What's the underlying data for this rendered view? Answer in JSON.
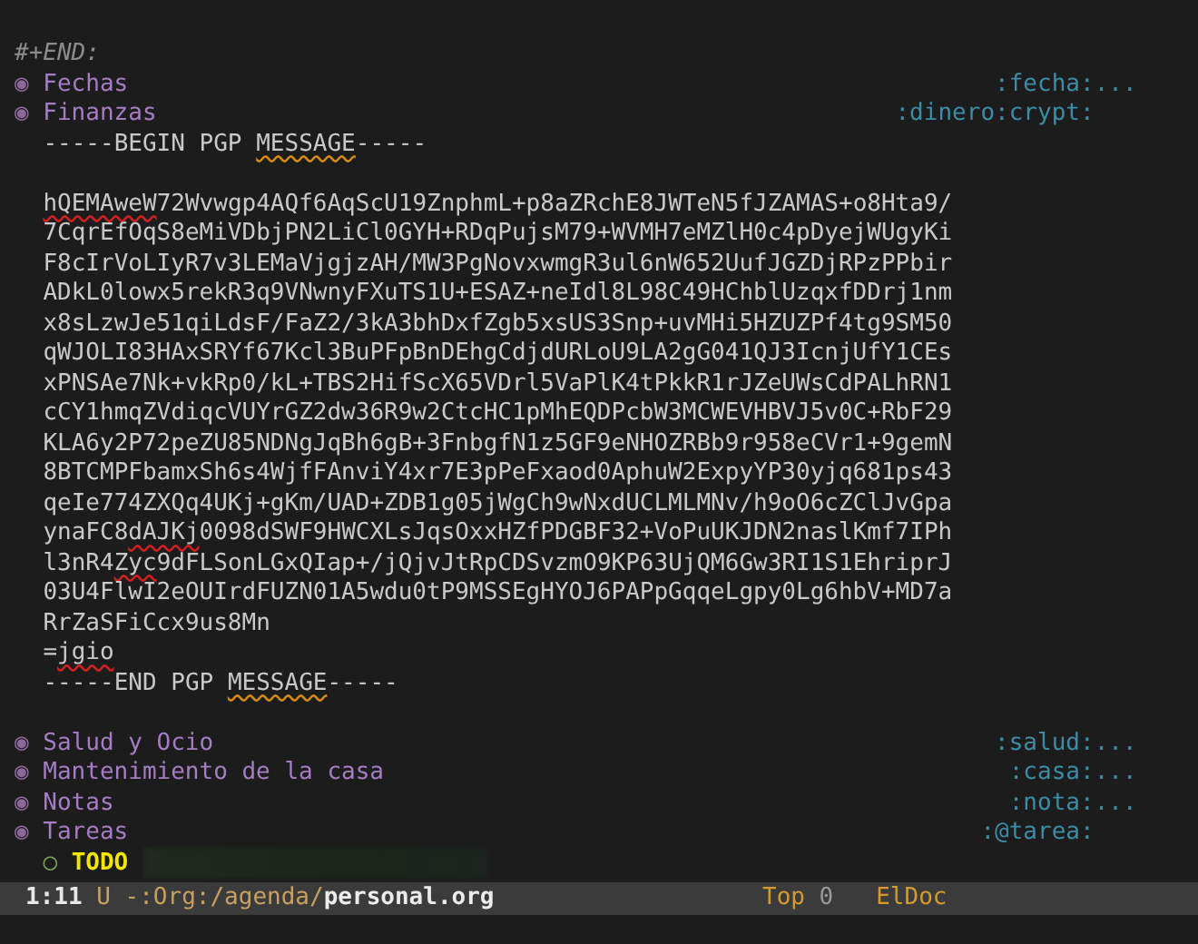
{
  "block_end": "#+END:",
  "headings_before": [
    {
      "bullet": "◉",
      "title": "Fechas",
      "tags": ":fecha:",
      "ellipsis": "..."
    },
    {
      "bullet": "◉",
      "title": "Finanzas",
      "tags": ":dinero:crypt:"
    }
  ],
  "pgp_block": {
    "lines": [
      {
        "kind": "text",
        "segments": [
          {
            "text": "-----BEGIN PGP "
          },
          {
            "text": "MESSAGE",
            "kind": "warning"
          },
          {
            "text": "-----"
          }
        ]
      },
      {
        "kind": "blank"
      },
      {
        "kind": "text",
        "segments": [
          {
            "text": "hQEMAweW",
            "kind": "error"
          },
          {
            "text": "72Wvwgp4AQf6AqScU19ZnphmL+p8aZRchE8JWTeN5fJZAMAS+o8Hta9/"
          }
        ]
      },
      {
        "kind": "text",
        "segments": [
          {
            "text": "7CqrEfOqS8eMiVDbjPN2LiCl0GYH+RDqPujsM79+WVMH7eMZlH0c4pDyejWUgyKi"
          }
        ]
      },
      {
        "kind": "text",
        "segments": [
          {
            "text": "F8cIrVoLIyR7v3LEMaVjgjzAH/MW3PgNovxwmgR3ul6nW652UufJGZDjRPzPPbir"
          }
        ]
      },
      {
        "kind": "text",
        "segments": [
          {
            "text": "ADkL0lowx5rekR3q9VNwnyFXuTS1U+ESAZ+neIdl8L98C49HChblUzqxfDDrj1nm"
          }
        ]
      },
      {
        "kind": "text",
        "segments": [
          {
            "text": "x8sLzwJe51qiLdsF/FaZ2/3kA3bhDxfZgb5xsUS3Snp+uvMHi5HZUZPf4tg9SM50"
          }
        ]
      },
      {
        "kind": "text",
        "segments": [
          {
            "text": "qWJOLI83HAxSRYf67Kcl3BuPFpBnDEhgCdjdURLoU9LA2gG041QJ3IcnjUfY1CEs"
          }
        ]
      },
      {
        "kind": "text",
        "segments": [
          {
            "text": "xPNSAe7Nk+vkRp0/kL+TBS2HifScX65VDrl5VaPlK4tPkkR1rJZeUWsCdPALhRN1"
          }
        ]
      },
      {
        "kind": "text",
        "segments": [
          {
            "text": "cCY1hmqZVdiqcVUYrGZ2dw36R9w2CtcHC1pMhEQDPcbW3MCWEVHBVJ5v0C+RbF29"
          }
        ]
      },
      {
        "kind": "text",
        "segments": [
          {
            "text": "KLA6y2P72peZU85NDNgJqBh6gB+3FnbgfN1z5GF9eNHOZRBb9r958eCVr1+9gemN"
          }
        ]
      },
      {
        "kind": "text",
        "segments": [
          {
            "text": "8BTCMPFbamxSh6s4WjfFAnviY4xr7E3pPeFxaod0AphuW2ExpyYP30yjq681ps43"
          }
        ]
      },
      {
        "kind": "text",
        "segments": [
          {
            "text": "qeIe774ZXQq4UKj+gKm/UAD+ZDB1g05jWgCh9wNxdUCLMLMNv/h9oO6cZClJvGpa"
          }
        ]
      },
      {
        "kind": "text",
        "segments": [
          {
            "text": "ynaFC8"
          },
          {
            "text": "dAJKj",
            "kind": "error"
          },
          {
            "text": "0098dSWF9HWCXLsJqsOxxHZfPDGBF32+VoPuUKJDN2naslKmf7IPh"
          }
        ]
      },
      {
        "kind": "text",
        "segments": [
          {
            "text": "l3nR4"
          },
          {
            "text": "Zyc",
            "kind": "error"
          },
          {
            "text": "9dFLSonLGxQIap+/jQjvJtRpCDSvzmO9KP63UjQM6Gw3RI1S1EhriprJ"
          }
        ]
      },
      {
        "kind": "text",
        "segments": [
          {
            "text": "03U4FlwI2eOUIrdFUZN01A5wdu0tP9MSSEgHYOJ6PAPpGqqeLgpy0Lg6hbV+MD7a"
          }
        ]
      },
      {
        "kind": "text",
        "segments": [
          {
            "text": "RrZaSFiCcx9us8Mn"
          }
        ]
      },
      {
        "kind": "text",
        "segments": [
          {
            "text": "="
          },
          {
            "text": "jgio",
            "kind": "error"
          }
        ]
      },
      {
        "kind": "text",
        "segments": [
          {
            "text": "-----END PGP "
          },
          {
            "text": "MESSAGE",
            "kind": "warning"
          },
          {
            "text": "-----"
          }
        ]
      },
      {
        "kind": "blank"
      }
    ]
  },
  "headings_after": [
    {
      "bullet": "◉",
      "title": "Salud y Ocio",
      "tags": ":salud:",
      "ellipsis": "..."
    },
    {
      "bullet": "◉",
      "title": "Mantenimiento de la casa",
      "tags": ":casa:",
      "ellipsis": "..."
    },
    {
      "bullet": "◉",
      "title": "Notas",
      "tags": ":nota:",
      "ellipsis": "..."
    },
    {
      "bullet": "◉",
      "title": "Tareas",
      "tags": ":@tarea:"
    }
  ],
  "todo_item": {
    "bullet": "○",
    "keyword": "TODO"
  },
  "mode_line": {
    "position": "1:11",
    "encoding": "U",
    "path": "-:Org:/agenda/",
    "filename": "personal.org",
    "scroll": "Top",
    "counter": "0",
    "mode": "ElDoc"
  }
}
